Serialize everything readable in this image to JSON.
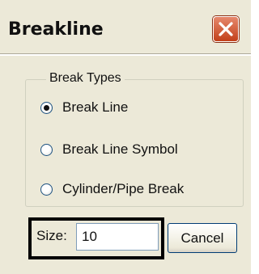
{
  "window": {
    "title": "Breakline"
  },
  "group": {
    "legend": "Break Types",
    "options": [
      {
        "label": "Break Line",
        "checked": true
      },
      {
        "label": "Break Line Symbol",
        "checked": false
      },
      {
        "label": "Cylinder/Pipe Break",
        "checked": false
      }
    ]
  },
  "size": {
    "label": "Size:",
    "value": "10"
  },
  "buttons": {
    "cancel_label": "Cancel"
  },
  "icons": {
    "close": "close-icon"
  },
  "colors": {
    "dialog_background": "#ece9d8",
    "close_button": "#c2401a"
  }
}
